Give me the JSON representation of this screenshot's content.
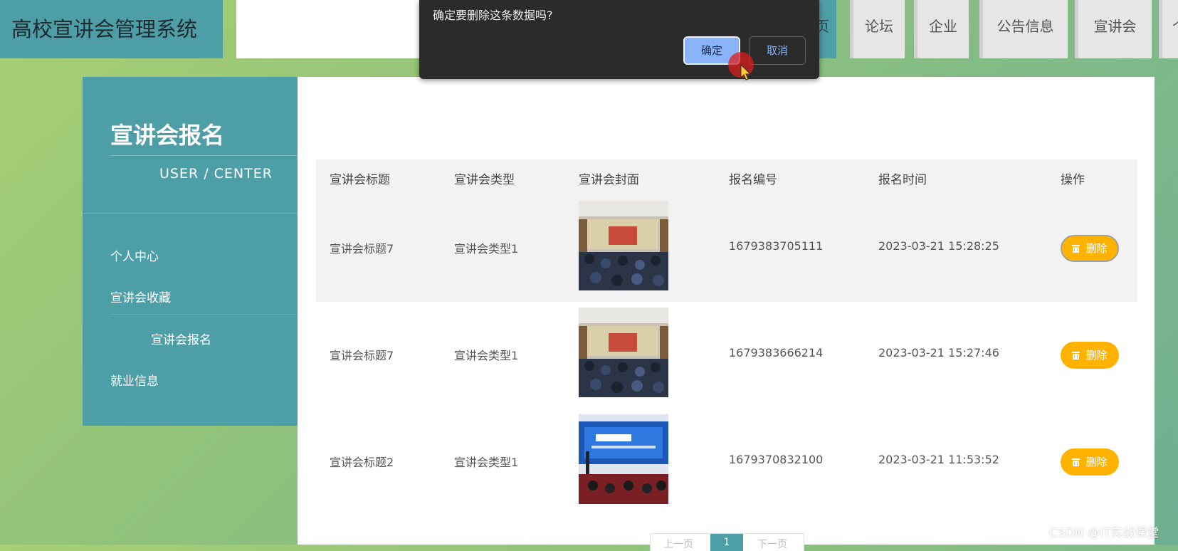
{
  "header": {
    "app_title": "高校宣讲会管理系统",
    "nav_partial": "页",
    "nav_items": [
      "论坛",
      "企业",
      "公告信息",
      "宣讲会",
      "个"
    ]
  },
  "dialog": {
    "message": "确定要删除这条数据吗?",
    "ok_label": "确定",
    "cancel_label": "取消"
  },
  "sidebar": {
    "title": "宣讲会报名",
    "subtitle": "USER / CENTER",
    "items": [
      {
        "label": "个人中心"
      },
      {
        "label": "宣讲会收藏"
      },
      {
        "label": "宣讲会报名"
      },
      {
        "label": "就业信息"
      }
    ]
  },
  "table": {
    "headers": [
      "宣讲会标题",
      "宣讲会类型",
      "宣讲会封面",
      "报名编号",
      "报名时间",
      "操作"
    ],
    "rows": [
      {
        "title": "宣讲会标题7",
        "type": "宣讲会类型1",
        "number": "1679383705111",
        "time": "2023-03-21 15:28:25",
        "action": "删除"
      },
      {
        "title": "宣讲会标题7",
        "type": "宣讲会类型1",
        "number": "1679383666214",
        "time": "2023-03-21 15:27:46",
        "action": "删除"
      },
      {
        "title": "宣讲会标题2",
        "type": "宣讲会类型1",
        "number": "1679370832100",
        "time": "2023-03-21 11:53:52",
        "action": "删除"
      }
    ]
  },
  "pagination": {
    "prev": "上一页",
    "current": "1",
    "next": "下一页"
  },
  "watermark": "CSDN @IT实战课堂",
  "colors": {
    "accent": "#4e9ea7",
    "delete_button": "#ffb300",
    "dialog_bg": "#2b2b2b",
    "ok_button": "#8ab4f8"
  }
}
